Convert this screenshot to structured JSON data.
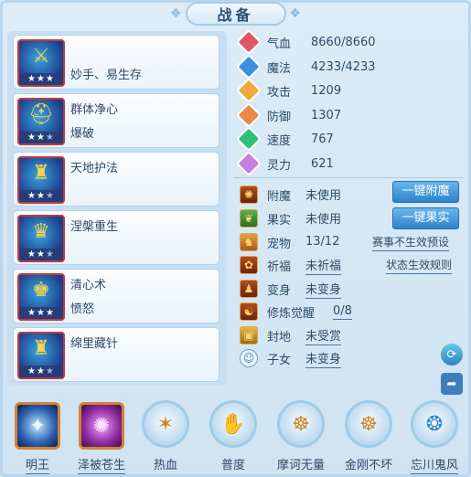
{
  "title": "战备",
  "skills": [
    {
      "name": "妙手、易生存",
      "sub": "",
      "stars": "★★★",
      "stars_off": "",
      "icon": "sword-icon"
    },
    {
      "name": "群体净心",
      "sub": "爆破",
      "stars": "★★",
      "stars_off": "★",
      "icon": "helmet-icon"
    },
    {
      "name": "天地护法",
      "sub": "",
      "stars": "★★",
      "stars_off": "★",
      "icon": "armor-icon"
    },
    {
      "name": "涅槃重生",
      "sub": "",
      "stars": "★★",
      "stars_off": "★",
      "icon": "crown-icon"
    },
    {
      "name": "清心术",
      "sub": "愤怒",
      "stars": "★★★",
      "stars_off": "",
      "icon": "crown-icon"
    },
    {
      "name": "绵里藏针",
      "sub": "",
      "stars": "★★",
      "stars_off": "★",
      "icon": "armor-icon"
    }
  ],
  "attributes": [
    {
      "label": "气血",
      "value": "8660/8660",
      "icon": "heart-icon",
      "color": "#e05563"
    },
    {
      "label": "魔法",
      "value": "4233/4233",
      "icon": "mana-icon",
      "color": "#3f8fe0"
    },
    {
      "label": "攻击",
      "value": "1209",
      "icon": "attack-icon",
      "color": "#f0a93a"
    },
    {
      "label": "防御",
      "value": "1307",
      "icon": "defense-icon",
      "color": "#e98a4a"
    },
    {
      "label": "速度",
      "value": "767",
      "icon": "speed-icon",
      "color": "#2fbf7a"
    },
    {
      "label": "灵力",
      "value": "621",
      "icon": "spirit-icon",
      "color": "#c77fe0"
    }
  ],
  "misc": [
    {
      "label": "附魔",
      "value": "未使用",
      "underline": false
    },
    {
      "label": "果实",
      "value": "未使用",
      "underline": false
    },
    {
      "label": "宠物",
      "value": "13/12",
      "underline": false
    },
    {
      "label": "祈福",
      "value": "未祈福",
      "underline": true
    },
    {
      "label": "变身",
      "value": "未变身",
      "underline": true
    },
    {
      "label": "修炼觉醒",
      "value": "0/8",
      "underline": true
    },
    {
      "label": "封地",
      "value": "未受赏",
      "underline": true
    },
    {
      "label": "子女",
      "value": "未变身",
      "underline": true
    }
  ],
  "buttons": {
    "enchant": "一键附魔",
    "fruit": "一键果实"
  },
  "links": {
    "event_preset": "赛事不生效预设",
    "state_rules": "状态生效规则"
  },
  "bottom": [
    {
      "label": "明王",
      "underline": true,
      "shape": "square",
      "color": "#2a5fb0",
      "glyph": "✦"
    },
    {
      "label": "泽被苍生",
      "underline": true,
      "shape": "square",
      "color": "#8e2a9e",
      "glyph": "✺"
    },
    {
      "label": "热血",
      "underline": false,
      "shape": "circle",
      "glyph": "✶"
    },
    {
      "label": "普度",
      "underline": false,
      "shape": "circle",
      "glyph": "✋"
    },
    {
      "label": "摩诃无量",
      "underline": false,
      "shape": "circle",
      "glyph": "☸"
    },
    {
      "label": "金刚不坏",
      "underline": false,
      "shape": "circle",
      "glyph": "☸"
    },
    {
      "label": "忘川鬼风",
      "underline": true,
      "shape": "circle",
      "glyph": "❂"
    }
  ]
}
